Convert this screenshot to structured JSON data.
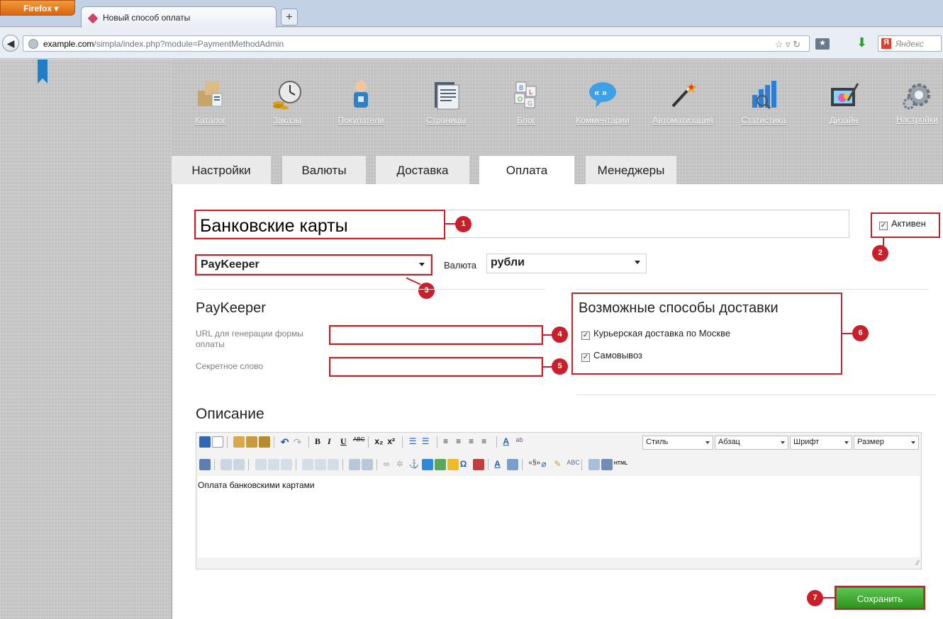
{
  "browser": {
    "firefox_button": "Firefox",
    "tab_title": "Новый способ оплаты",
    "new_tab": "+",
    "url_host": "example.com",
    "url_path": "/simpla/index.php?module=PaymentMethodAdmin",
    "search_engine": "Яндекс"
  },
  "menu": [
    {
      "label": "Каталог",
      "icon": "boxes-icon"
    },
    {
      "label": "Заказы",
      "icon": "clock-coins-icon"
    },
    {
      "label": "Покупатели",
      "icon": "customer-icon"
    },
    {
      "label": "Страницы",
      "icon": "pages-icon"
    },
    {
      "label": "Блог",
      "icon": "blog-icon"
    },
    {
      "label": "Комментарии",
      "icon": "comments-icon"
    },
    {
      "label": "Автоматизация",
      "icon": "magic-wand-icon"
    },
    {
      "label": "Статистика",
      "icon": "statistics-icon"
    },
    {
      "label": "Дизайн",
      "icon": "design-icon"
    },
    {
      "label": "Настройки",
      "icon": "gear-icon"
    }
  ],
  "tabs": [
    {
      "label": "Настройки",
      "active": false
    },
    {
      "label": "Валюты",
      "active": false
    },
    {
      "label": "Доставка",
      "active": false
    },
    {
      "label": "Оплата",
      "active": true
    },
    {
      "label": "Менеджеры",
      "active": false
    }
  ],
  "form": {
    "name_value": "Банковские карты",
    "active_label": "Активен",
    "active_checked": true,
    "module_value": "PayKeeper",
    "currency_label": "Валюта",
    "currency_value": "рубли",
    "module_heading": "PayKeeper",
    "url_label": "URL для генерации формы оплаты",
    "url_value": "",
    "secret_label": "Секретное слово",
    "secret_value": "",
    "delivery_heading": "Возможные способы доставки",
    "delivery_options": [
      {
        "label": "Курьерская доставка по Москве",
        "checked": true
      },
      {
        "label": "Самовывоз",
        "checked": true
      }
    ],
    "description_heading": "Описание",
    "description_text": "Оплата банковскими картами",
    "save_label": "Сохранить"
  },
  "editor": {
    "style_combo": "Стиль",
    "format_combo": "Абзац",
    "font_combo": "Шрифт",
    "size_combo": "Размер",
    "html_button": "HTML"
  },
  "callouts": [
    "1",
    "2",
    "3",
    "4",
    "5",
    "6",
    "7"
  ],
  "colors": {
    "callout": "#c81f2b",
    "save_button": "#3ea52e",
    "link": "#ffffff"
  }
}
